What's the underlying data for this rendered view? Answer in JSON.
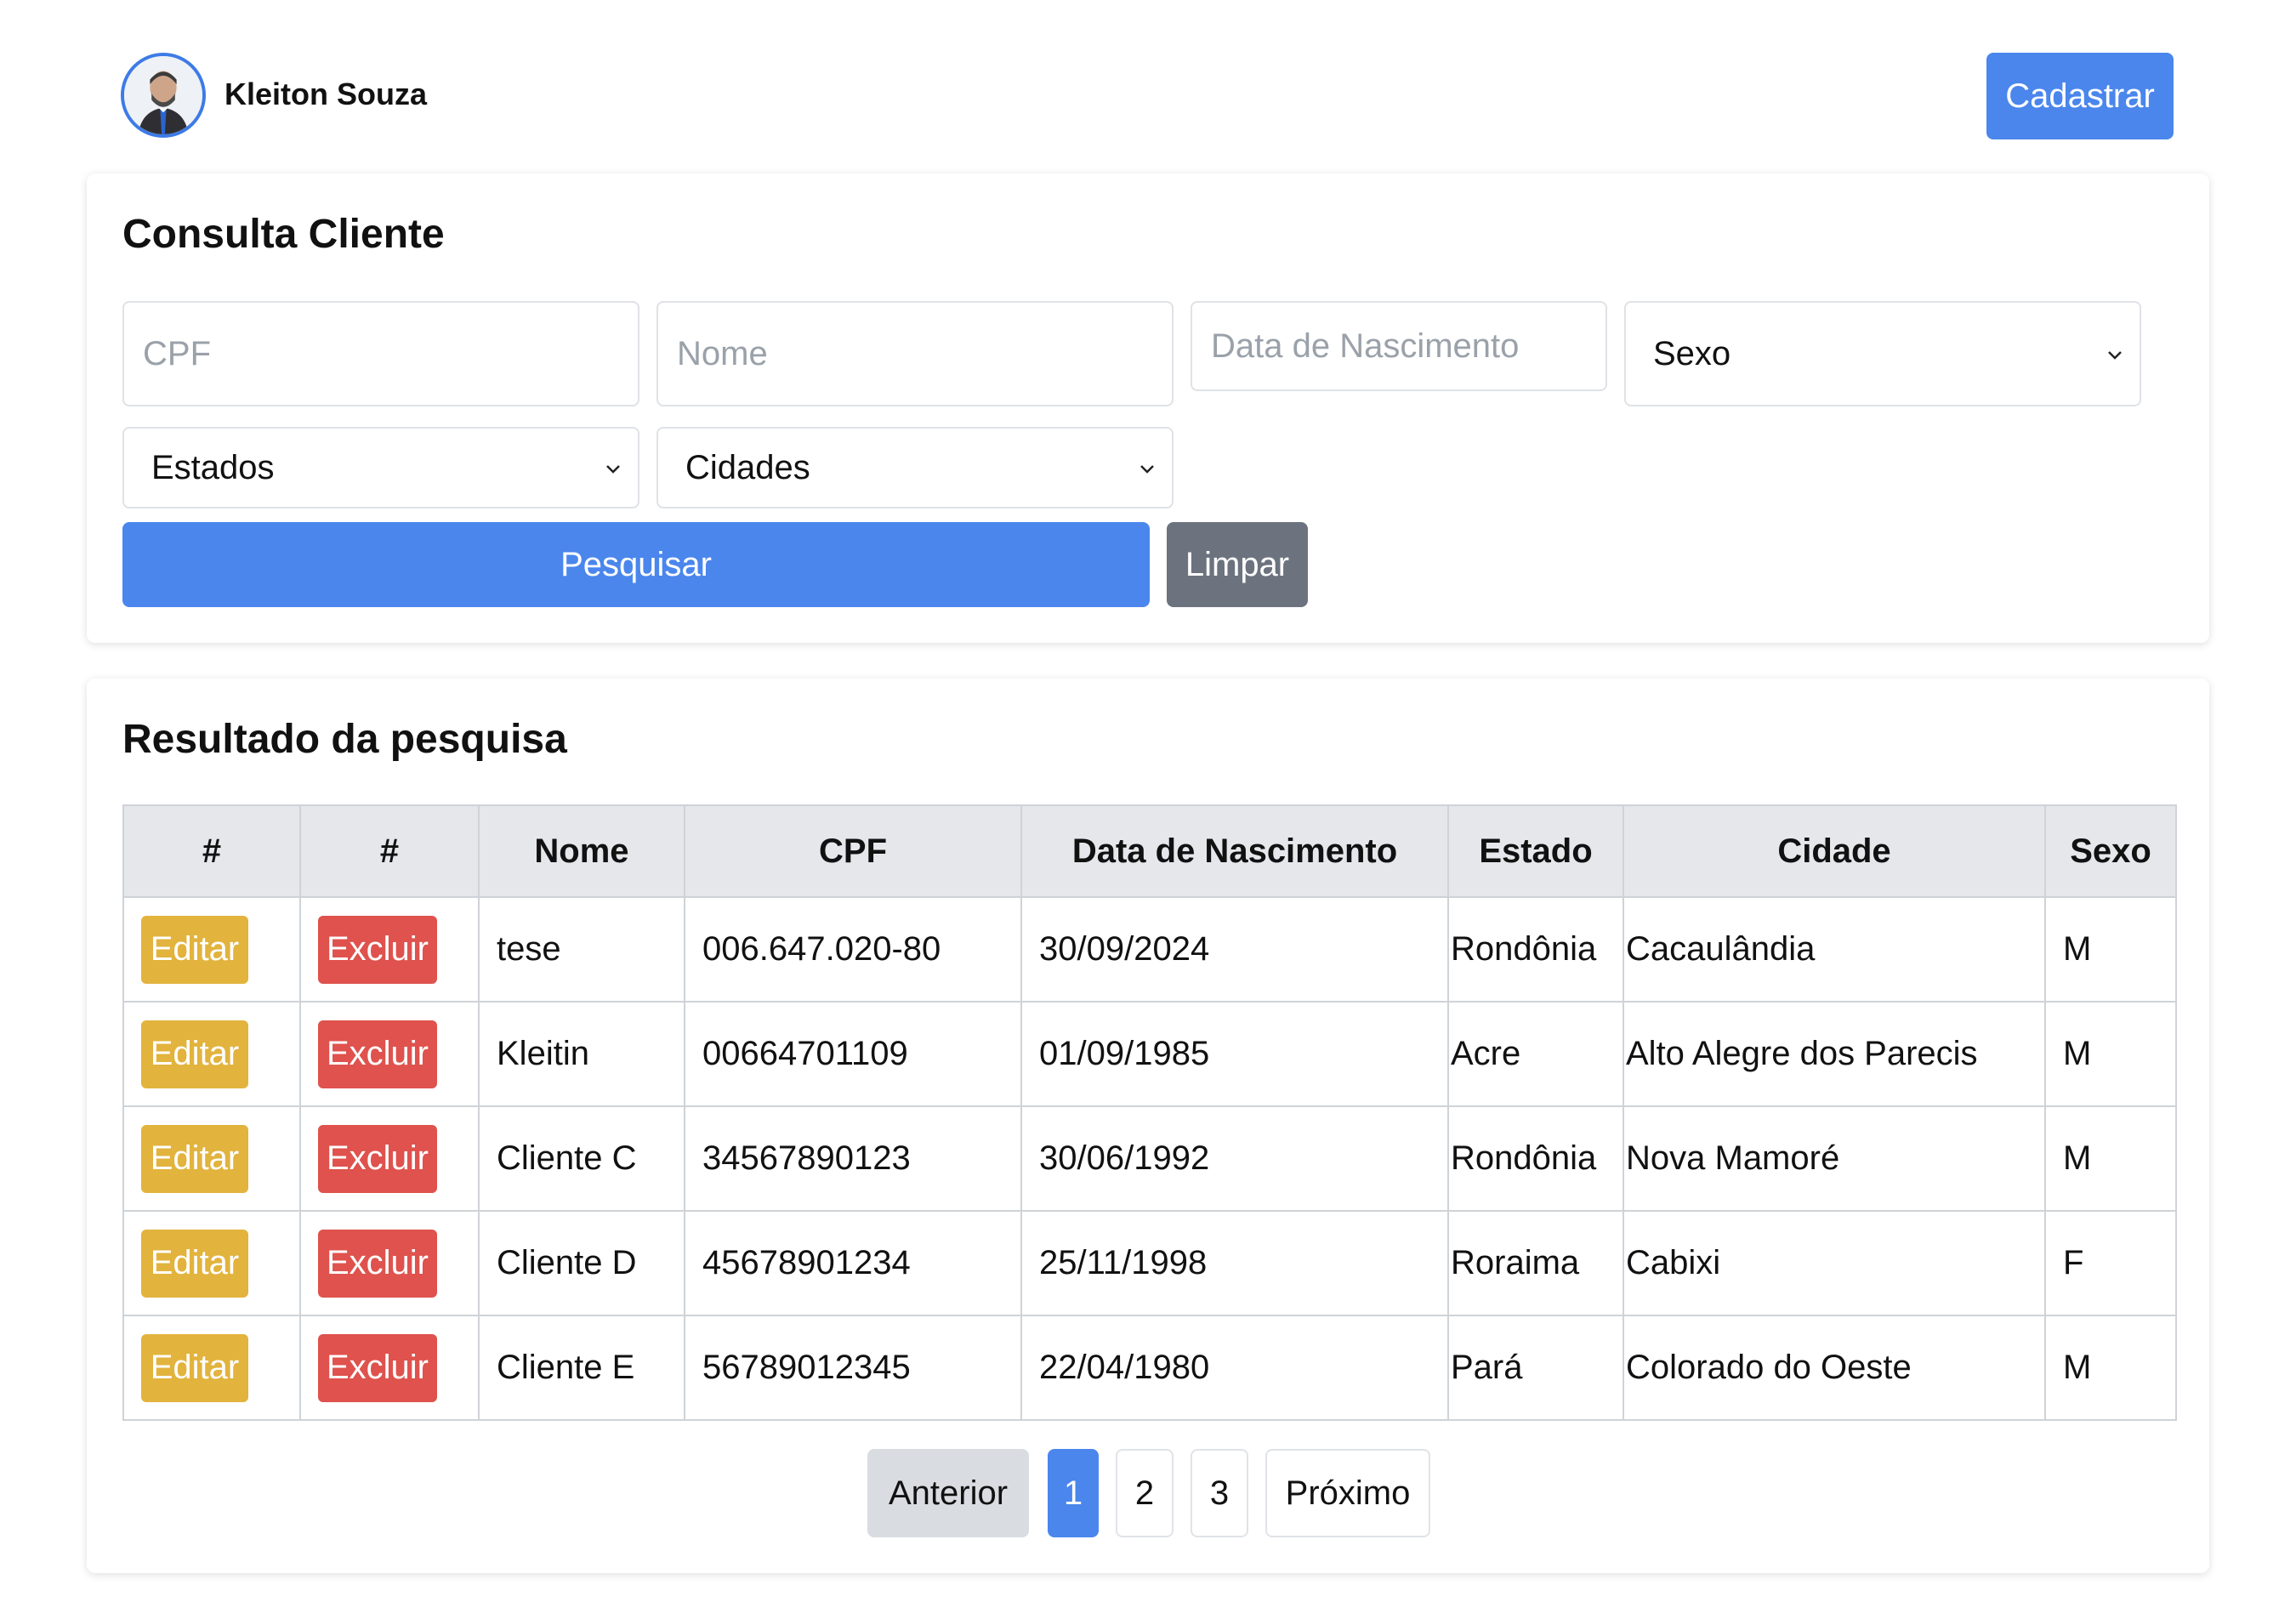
{
  "header": {
    "user_name": "Kleiton Souza",
    "register_label": "Cadastrar"
  },
  "search": {
    "title": "Consulta Cliente",
    "cpf_placeholder": "CPF",
    "nome_placeholder": "Nome",
    "data_placeholder": "Data de Nascimento",
    "sexo_selected": "Sexo",
    "estados_selected": "Estados",
    "cidades_selected": "Cidades",
    "search_label": "Pesquisar",
    "clear_label": "Limpar"
  },
  "results": {
    "title": "Resultado da pesquisa",
    "columns": [
      "#",
      "#",
      "Nome",
      "CPF",
      "Data de Nascimento",
      "Estado",
      "Cidade",
      "Sexo"
    ],
    "edit_label": "Editar",
    "delete_label": "Excluir",
    "rows": [
      {
        "nome": "tese",
        "cpf": "006.647.020-80",
        "nascimento": "30/09/2024",
        "estado": "Rondônia",
        "cidade": "Cacaulândia",
        "sexo": "M"
      },
      {
        "nome": "Kleitin",
        "cpf": "00664701109",
        "nascimento": "01/09/1985",
        "estado": "Acre",
        "cidade": "Alto Alegre dos Parecis",
        "sexo": "M"
      },
      {
        "nome": "Cliente C",
        "cpf": "34567890123",
        "nascimento": "30/06/1992",
        "estado": "Rondônia",
        "cidade": "Nova Mamoré",
        "sexo": "M"
      },
      {
        "nome": "Cliente D",
        "cpf": "45678901234",
        "nascimento": "25/11/1998",
        "estado": "Roraima",
        "cidade": "Cabixi",
        "sexo": "F"
      },
      {
        "nome": "Cliente E",
        "cpf": "56789012345",
        "nascimento": "22/04/1980",
        "estado": "Pará",
        "cidade": "Colorado do Oeste",
        "sexo": "M"
      }
    ]
  },
  "pagination": {
    "prev_label": "Anterior",
    "pages": [
      "1",
      "2",
      "3"
    ],
    "current_page": "1",
    "next_label": "Próximo"
  },
  "colors": {
    "primary": "#4a86ec",
    "secondary": "#6c737f",
    "warning": "#e2b33d",
    "danger": "#df524d"
  }
}
